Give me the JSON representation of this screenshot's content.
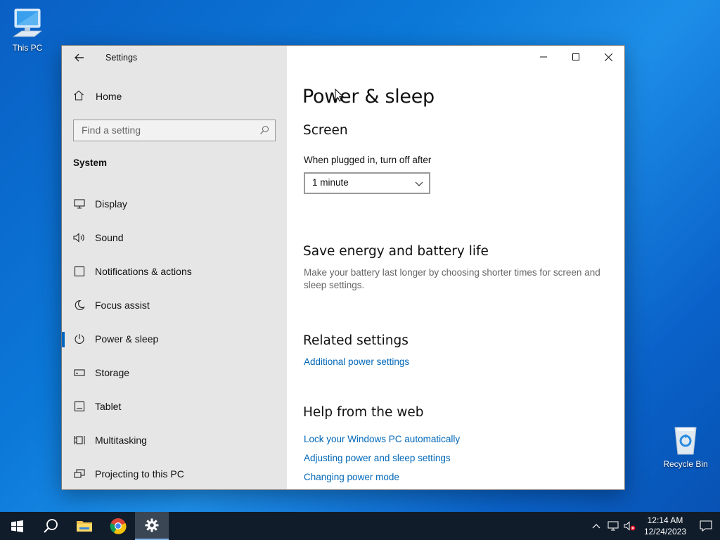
{
  "desktop": {
    "icons": [
      {
        "label": "This PC",
        "icon": "computer-icon"
      },
      {
        "label": "Recycle Bin",
        "icon": "recycle-bin-icon"
      }
    ]
  },
  "window": {
    "app_title": "Settings",
    "nav": {
      "home_label": "Home",
      "search_placeholder": "Find a setting",
      "section_label": "System",
      "items": [
        {
          "label": "Display",
          "icon": "monitor-icon"
        },
        {
          "label": "Sound",
          "icon": "speaker-icon"
        },
        {
          "label": "Notifications & actions",
          "icon": "notification-icon"
        },
        {
          "label": "Focus assist",
          "icon": "moon-icon"
        },
        {
          "label": "Power & sleep",
          "icon": "power-icon",
          "selected": true
        },
        {
          "label": "Storage",
          "icon": "storage-icon"
        },
        {
          "label": "Tablet",
          "icon": "tablet-icon"
        },
        {
          "label": "Multitasking",
          "icon": "multitasking-icon"
        },
        {
          "label": "Projecting to this PC",
          "icon": "projecting-icon"
        }
      ]
    },
    "content": {
      "page_title": "Power & sleep",
      "screen_heading": "Screen",
      "plugged_in_label": "When plugged in, turn off after",
      "plugged_in_value": "1 minute",
      "save_energy_heading": "Save energy and battery life",
      "save_energy_desc": "Make your battery last longer by choosing shorter times for screen and sleep settings.",
      "related_heading": "Related settings",
      "related_link": "Additional power settings",
      "help_heading": "Help from the web",
      "help_links": [
        "Lock your Windows PC automatically",
        "Adjusting power and sleep settings",
        "Changing power mode"
      ]
    }
  },
  "taskbar": {
    "apps": [
      "start-icon",
      "search-icon",
      "file-explorer-icon",
      "chrome-icon",
      "settings-icon"
    ],
    "active_app": "settings-icon",
    "time": "12:14 AM",
    "date": "12/24/2023"
  },
  "colors": {
    "accent": "#0067c0",
    "link": "#0067b8",
    "nav_bg": "#e6e6e6",
    "taskbar_bg": "#101c2a"
  }
}
